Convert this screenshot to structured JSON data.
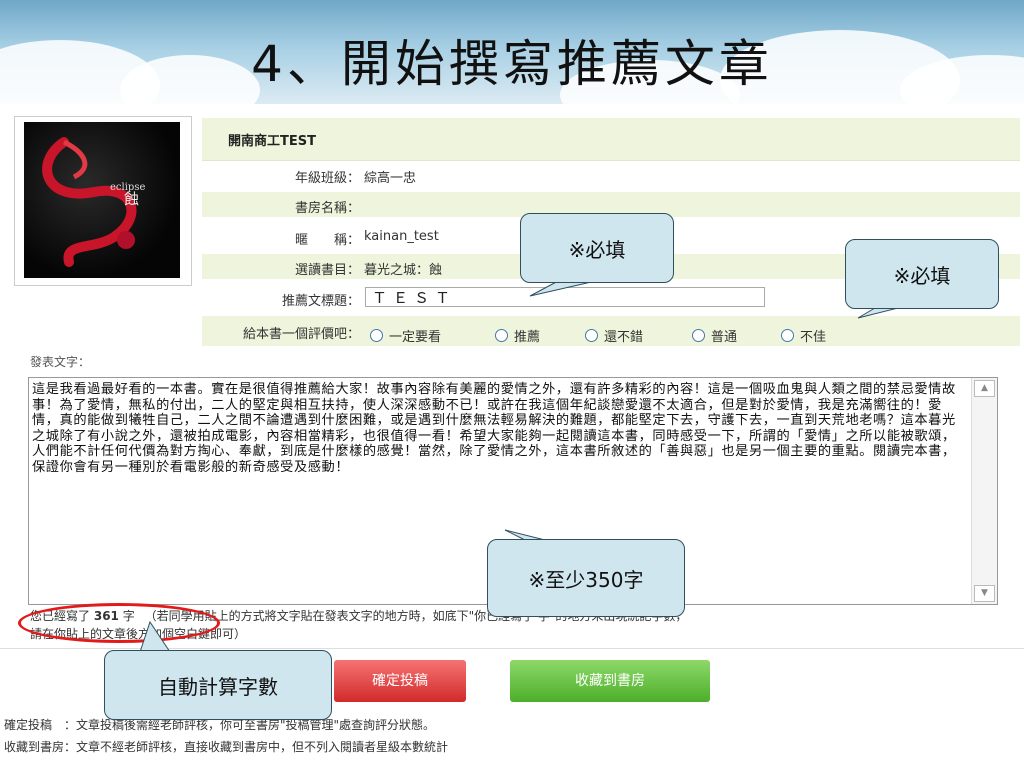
{
  "slide": {
    "title": "4、開始撰寫推薦文章"
  },
  "form": {
    "school": "開南商工TEST",
    "rows": [
      {
        "label": "年級班級：",
        "value": "綜高一忠"
      },
      {
        "label": "書房名稱：",
        "value": ""
      },
      {
        "label": "暱　　稱：",
        "value": "kainan_test"
      },
      {
        "label": "選讀書目：",
        "value": "暮光之城：蝕"
      }
    ],
    "title_label": "推薦文標題：",
    "title_value": "ＴＥＳＴ",
    "rating_label": "給本書一個評價吧：",
    "rating_options": [
      "一定要看",
      "推薦",
      "還不錯",
      "普通",
      "不佳"
    ],
    "post_label": "發表文字：",
    "article": "這是我看過最好看的一本書。實在是很值得推薦給大家！故事內容除有美麗的愛情之外，還有許多精彩的內容！這是一個吸血鬼與人類之間的禁忌愛情故事！為了愛情，無私的付出，二人的堅定與相互扶持，使人深深感動不已！或許在我這個年紀談戀愛還不太適合，但是對於愛情，我是充滿嚮往的！愛情，真的能做到犧牲自己，二人之間不論遭遇到什麼困難，或是遇到什麼無法輕易解決的難題，都能堅定下去，守護下去，一直到天荒地老嗎？這本暮光之城除了有小說之外，還被拍成電影，內容相當精彩，也很值得一看！希望大家能夠一起閱讀這本書，同時感受一下，所謂的「愛情」之所以能被歌頌，人們能不計任何代價為對方掏心、奉獻，到底是什麼樣的感覺！當然，除了愛情之外，這本書所敘述的「善與惡」也是另一個主要的重點。閱讀完本書，保證你會有另一種別於看電影般的新奇感受及感動！",
    "count_prefix": "您已經寫了",
    "count": "361",
    "count_suffix": "字",
    "count_hint": "（若同學用貼上的方式將文字貼在發表文字的地方時，如底下\"你已經寫了 字\"的地方未出現統記字數，",
    "count_hint2": "請在你貼上的文章後方加個空白鍵即可）"
  },
  "buttons": {
    "submit": "確定投稿",
    "collect": "收藏到書房"
  },
  "notes": [
    {
      "label": "確定投稿　：",
      "text": "文章投稿後需經老師評核，你可至書房\"投稿管理\"處查詢評分狀態。"
    },
    {
      "label": "收藏到書房：",
      "text": "文章不經老師評核，直接收藏到書房中，但不列入閱讀者星級本數統計"
    }
  ],
  "callouts": {
    "required1": "※必填",
    "required2": "※必填",
    "min_words": "※至少350字",
    "auto_count": "自動計算字數"
  },
  "colors": {
    "row_green": "#eef5dc",
    "callout_bg": "#cfe6ef",
    "submit": "#e04444",
    "collect": "#5cbf35",
    "highlight": "#e21a1a"
  }
}
